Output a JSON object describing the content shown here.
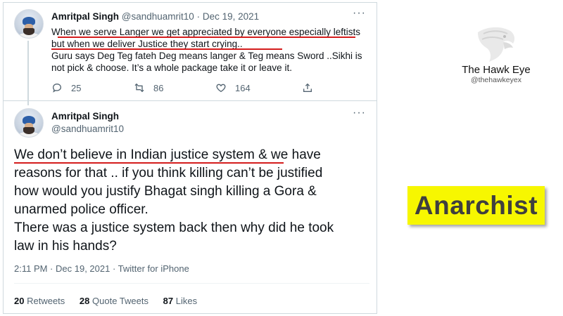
{
  "tweet1": {
    "author_name": "Amritpal Singh",
    "author_handle": "@sandhuamrit10",
    "date": "Dec 19, 2021",
    "header_separator": "·",
    "more_label": "···",
    "lines": [
      "When we serve Langer we get appreciated by everyone especially leftists",
      "but when we deliver Justice they start crying..",
      "Guru says Deg Teg fateh Deg means langer & Teg means Sword ..Sikhi is",
      "not pick & choose. It’s a whole package take it or leave it."
    ],
    "replies": "25",
    "retweets": "86",
    "likes": "164"
  },
  "tweet2": {
    "author_name": "Amritpal Singh",
    "author_handle": "@sandhuamrit10",
    "more_label": "···",
    "lines": [
      "We don’t believe in Indian justice system & we have",
      "reasons for that .. if you think killing can’t be justified",
      "how would you justify Bhagat singh killing a Gora &",
      "unarmed police officer.",
      "There was a justice system back then why did he took",
      "law in his hands?"
    ],
    "meta": "2:11 PM · Dec 19, 2021 · Twitter for iPhone",
    "retweets_count": "20",
    "retweets_label": "Retweets",
    "quote_tweets_count": "28",
    "quote_tweets_label": "Quote Tweets",
    "likes_count": "87",
    "likes_label": "Likes"
  },
  "watermark": {
    "title": "The Hawk Eye",
    "handle": "@thehawkeyex"
  },
  "badge": {
    "label": "Anarchist",
    "background": "#f7f700"
  },
  "icons": [
    "reply-icon",
    "retweet-icon",
    "like-icon",
    "share-icon",
    "more-icon"
  ],
  "colors": {
    "underline": "#d41c1c",
    "secondary_text": "#536471"
  }
}
